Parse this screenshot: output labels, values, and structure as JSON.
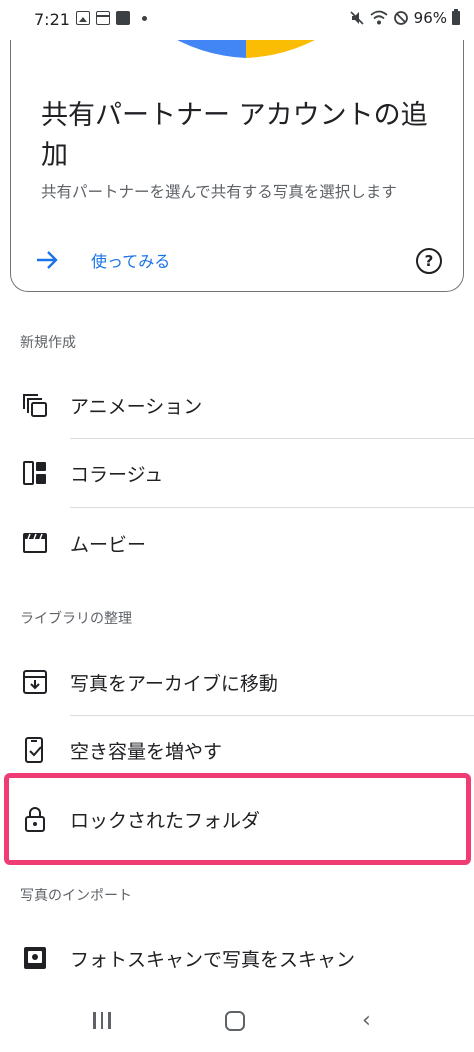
{
  "status_bar": {
    "time": "7:21",
    "battery": "96%",
    "left_icons": [
      "image-icon",
      "browser-icon",
      "calendar-icon",
      "dot-icon"
    ],
    "right_icons": [
      "mute-icon",
      "wifi-icon",
      "no-disturb-icon",
      "battery-icon"
    ]
  },
  "promo": {
    "illustration_colors": [
      "#4285f4",
      "#fbbc04"
    ],
    "title": "共有パートナー アカウントの追加",
    "subtitle": "共有パートナーを選んで共有する写真を選択します",
    "action_label": "使ってみる",
    "action_icon": "arrow-right-icon",
    "help_icon": "help-icon",
    "help_glyph": "?"
  },
  "sections": {
    "create": {
      "header": "新規作成",
      "items": [
        {
          "label": "アニメーション",
          "icon": "animation-icon"
        },
        {
          "label": "コラージュ",
          "icon": "collage-icon"
        },
        {
          "label": "ムービー",
          "icon": "movie-icon"
        }
      ]
    },
    "library": {
      "header": "ライブラリの整理",
      "items": [
        {
          "label": "写真をアーカイブに移動",
          "icon": "archive-icon"
        },
        {
          "label": "空き容量を増やす",
          "icon": "free-space-icon"
        },
        {
          "label": "ロックされたフォルダ",
          "icon": "lock-icon"
        }
      ]
    },
    "import": {
      "header": "写真のインポート",
      "items": [
        {
          "label": "フォトスキャンで写真をスキャン",
          "icon": "photoscan-icon"
        }
      ]
    }
  },
  "highlight_color": "#ef3c74",
  "accent_color": "#1a73e8",
  "nav": {
    "icons": [
      "recents-icon",
      "home-icon",
      "back-icon"
    ],
    "back_glyph": "‹"
  }
}
